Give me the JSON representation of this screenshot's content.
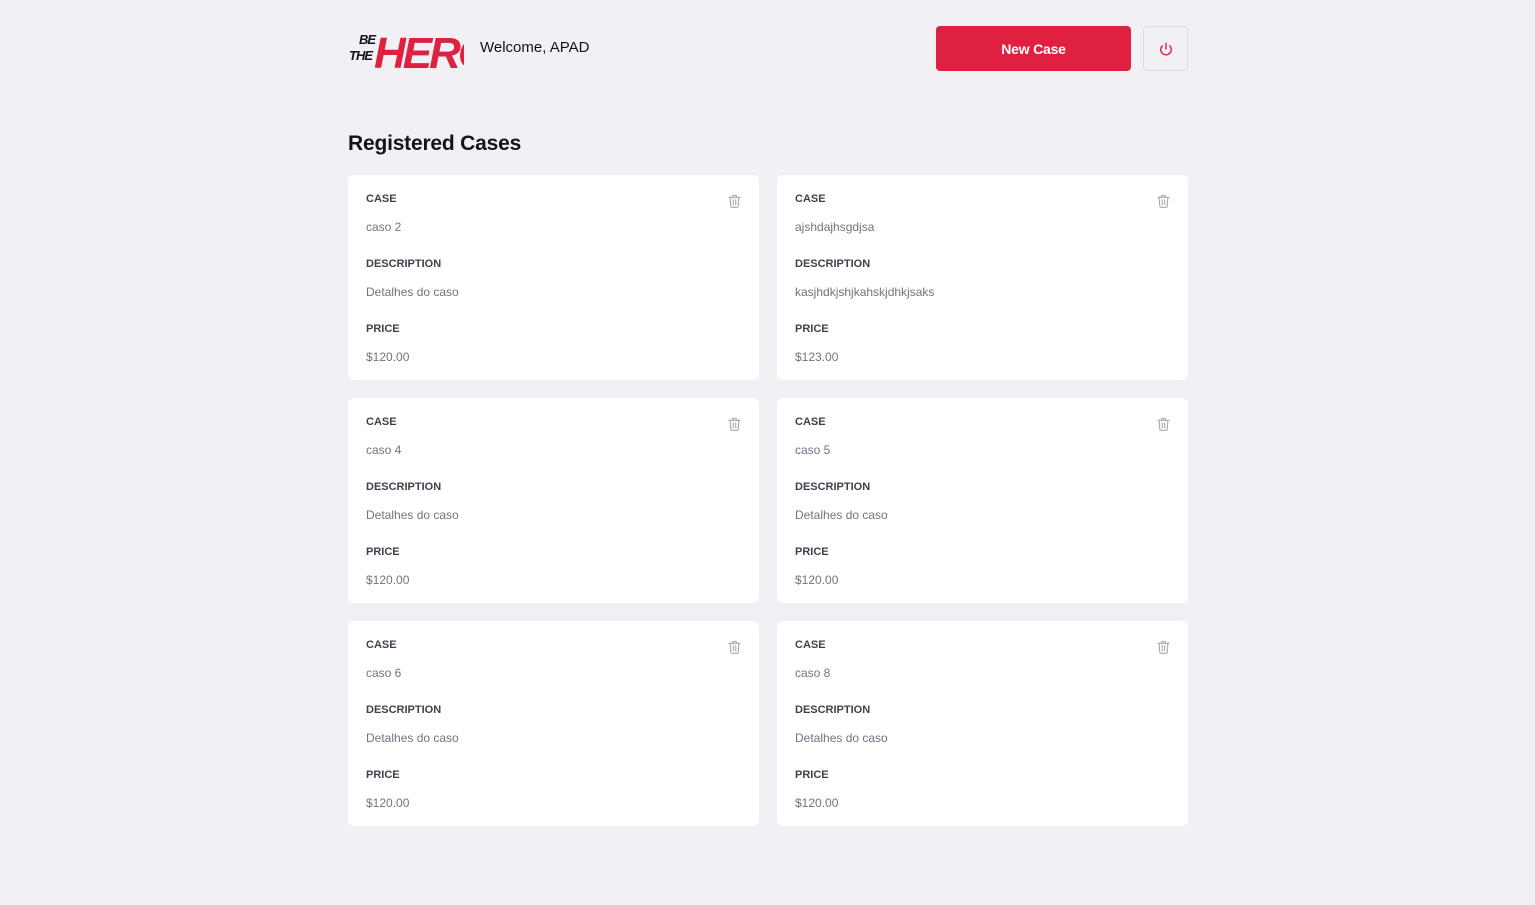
{
  "header": {
    "logo_alt": "Be The Hero",
    "welcome_text": "Welcome, APAD",
    "new_case_label": "New Case",
    "logout_icon": "power-icon"
  },
  "page": {
    "title": "Registered Cases"
  },
  "labels": {
    "case": "CASE",
    "description": "DESCRIPTION",
    "price": "PRICE"
  },
  "cases": [
    {
      "title": "caso 2",
      "description": "Detalhes do caso",
      "price": "$120.00"
    },
    {
      "title": "ajshdajhsgdjsa",
      "description": "kasjhdkjshjkahskjdhkjsaks",
      "price": "$123.00"
    },
    {
      "title": "caso 4",
      "description": "Detalhes do caso",
      "price": "$120.00"
    },
    {
      "title": "caso 5",
      "description": "Detalhes do caso",
      "price": "$120.00"
    },
    {
      "title": "caso 6",
      "description": "Detalhes do caso",
      "price": "$120.00"
    },
    {
      "title": "caso 8",
      "description": "Detalhes do caso",
      "price": "$120.00"
    }
  ],
  "colors": {
    "accent": "#e02041",
    "background": "#f0f0f5",
    "card": "#ffffff",
    "label": "#41414d",
    "value": "#737380",
    "trash": "#a8a8b3"
  }
}
